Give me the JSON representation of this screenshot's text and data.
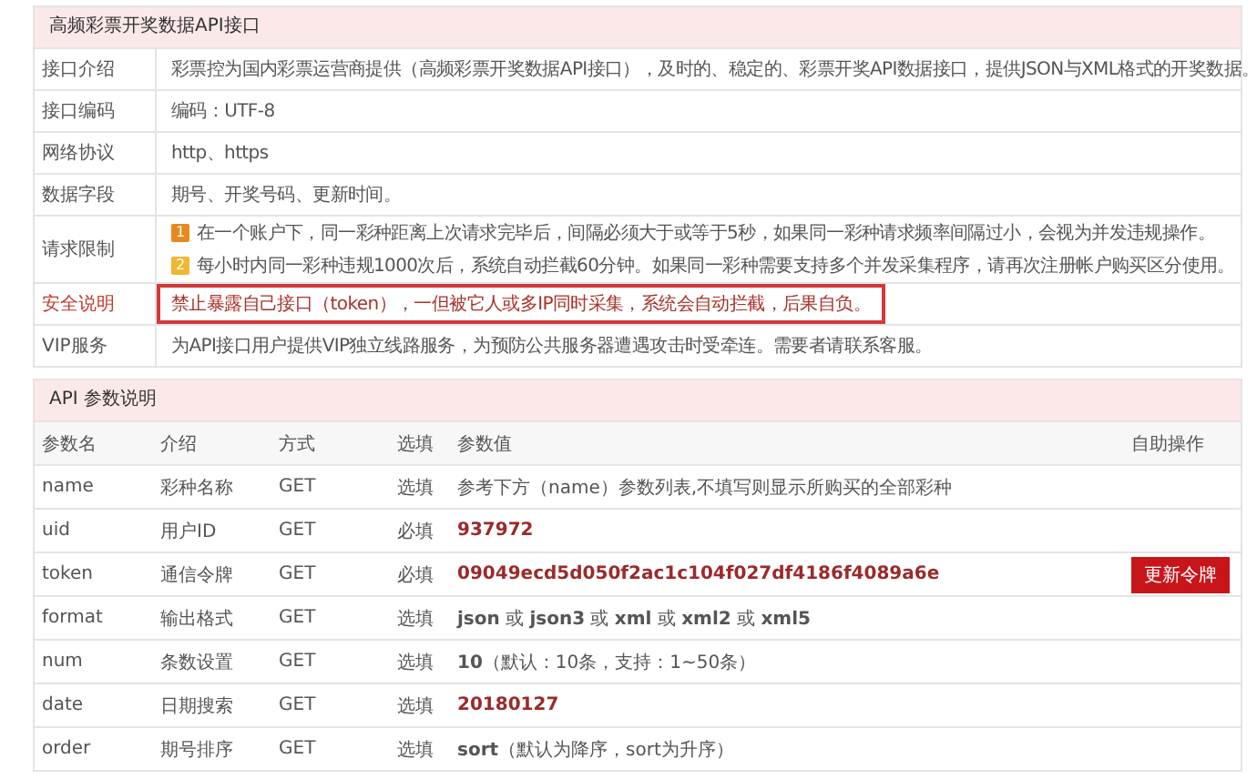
{
  "info_panel": {
    "title": "高频彩票开奖数据API接口",
    "rows": [
      {
        "kind": "text",
        "label": "接口介绍",
        "value": "彩票控为国内彩票运营商提供（高频彩票开奖数据API接口），及时的、稳定的、彩票开奖API数据接口，提供JSON与XML格式的开奖数据。",
        "highlighted": false
      },
      {
        "kind": "text",
        "label": "接口编码",
        "value": "编码：UTF-8",
        "highlighted": false
      },
      {
        "kind": "text",
        "label": "网络协议",
        "value": "http、https",
        "highlighted": false
      },
      {
        "kind": "text",
        "label": "数据字段",
        "value": "期号、开奖号码、更新时间。",
        "highlighted": false
      },
      {
        "kind": "list",
        "label": "请求限制",
        "highlighted": false,
        "items": [
          {
            "badge": "1",
            "color": "#e8891c",
            "text": "在一个账户下，同一彩种距离上次请求完毕后，间隔必须大于或等于5秒，如果同一彩种请求频率间隔过小，会视为并发违规操作。"
          },
          {
            "badge": "2",
            "color": "#f2b631",
            "text": "每小时内同一彩种违规1000次后，系统自动拦截60分钟。如果同一彩种需要支持多个并发采集程序，请再次注册帐户购买区分使用。"
          }
        ]
      },
      {
        "kind": "text",
        "label": "安全说明",
        "value": "禁止暴露自己接口（token），一但被它人或多IP同时采集，系统会自动拦截，后果自负。",
        "highlighted": true
      },
      {
        "kind": "text",
        "label": "VIP服务",
        "value": "为API接口用户提供VIP独立线路服务，为预防公共服务器遭遇攻击时受牵连。需要者请联系客服。",
        "highlighted": false
      }
    ]
  },
  "params_panel": {
    "title": "API 参数说明",
    "columns": [
      "参数名",
      "介绍",
      "方式",
      "选填",
      "参数值",
      "自助操作"
    ],
    "rows": [
      {
        "name": "name",
        "intro": "彩种名称",
        "method": "GET",
        "required": "选填",
        "value": "参考下方（name）参数列表,不填写则显示所购买的全部彩种",
        "bold": false
      },
      {
        "name": "uid",
        "intro": "用户ID",
        "method": "GET",
        "required": "必填",
        "value": "937972",
        "bold": true
      },
      {
        "name": "token",
        "intro": "通信令牌",
        "method": "GET",
        "required": "必填",
        "value": "09049ecd5d050f2ac1c104f027df4186f4089a6e",
        "bold": true,
        "action": "更新令牌"
      },
      {
        "name": "format",
        "intro": "输出格式",
        "method": "GET",
        "required": "选填",
        "value": "**json** 或 **json3** 或 **xml** 或 **xml2** 或 **xml5**",
        "bold": false
      },
      {
        "name": "num",
        "intro": "条数设置",
        "method": "GET",
        "required": "选填",
        "value": "**10**（默认：10条，支持：1~50条）",
        "bold": false
      },
      {
        "name": "date",
        "intro": "日期搜索",
        "method": "GET",
        "required": "选填",
        "value": "20180127",
        "bold": true
      },
      {
        "name": "order",
        "intro": "期号排序",
        "method": "GET",
        "required": "选填",
        "value": "**sort**（默认为降序，sort为升序）",
        "bold": false
      }
    ]
  }
}
